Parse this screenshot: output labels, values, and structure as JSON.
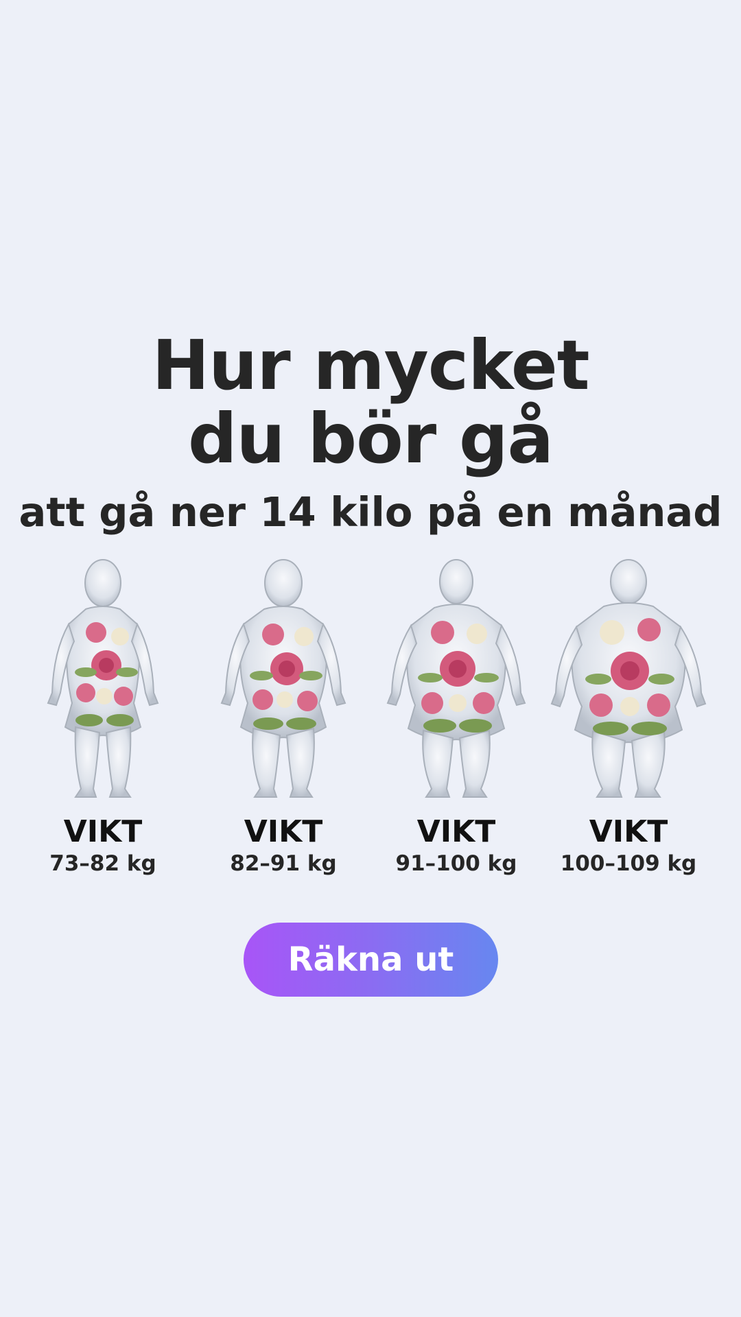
{
  "headline": {
    "line1": "Hur mycket",
    "line2": "du bör gå",
    "subtitle": "att gå ner 14 kilo på en månad"
  },
  "options": [
    {
      "title": "VIKT",
      "range": "73–82 kg",
      "icon": "glass-body-flowers-slim"
    },
    {
      "title": "VIKT",
      "range": "82–91 kg",
      "icon": "glass-body-flowers-medium"
    },
    {
      "title": "VIKT",
      "range": "91–100 kg",
      "icon": "glass-body-flowers-large"
    },
    {
      "title": "VIKT",
      "range": "100–109 kg",
      "icon": "glass-body-flowers-xlarge"
    }
  ],
  "cta": {
    "label": "Räkna ut"
  },
  "colors": {
    "background": "#edf0f8",
    "text": "#262626",
    "cta_gradient_start": "#a855f7",
    "cta_gradient_end": "#6787f0"
  }
}
